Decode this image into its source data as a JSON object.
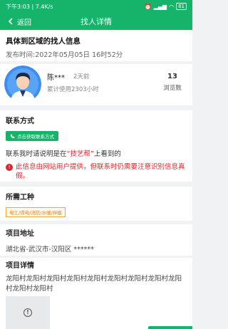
{
  "status_bar": {
    "time_speed": "下午3:03 | 7.4K/s",
    "battery": "81"
  },
  "nav": {
    "back_label": "返回",
    "title": "找人详情"
  },
  "header": {
    "title": "具体到区域的找人信息",
    "publish_time": "发布时间:2022年05月05日 16时52分"
  },
  "profile": {
    "name": "陈***",
    "ago": "2天前",
    "usage": "累计使用2303小时",
    "views_count": "13",
    "views_label": "浏览数"
  },
  "contact": {
    "section_title": "联系方式",
    "button_label": "点击获取联系方式",
    "tip_prefix": "联系我时请说明是在",
    "tip_brand": "“技艺帮”",
    "tip_suffix": "上看到的",
    "warning": "此信息由网站用户提供，但联系时仍需要注意识别信息真假。"
  },
  "work": {
    "section_title": "所需工种",
    "tag": "电工/焊电/消防/水暖/拌模"
  },
  "address": {
    "section_title": "项目地址",
    "value": "湖北省-武汉市-汉阳区 ******"
  },
  "detail": {
    "section_title": "项目详情",
    "text": "龙阳村龙阳村龙阳村龙阳村龙阳村龙阳村龙阳村龙阳村龙阳村龙阳村龙阳村"
  },
  "colors": {
    "brand_green": "#16b36a",
    "warning_red": "#e0242c",
    "tag_orange": "#f0a830"
  }
}
